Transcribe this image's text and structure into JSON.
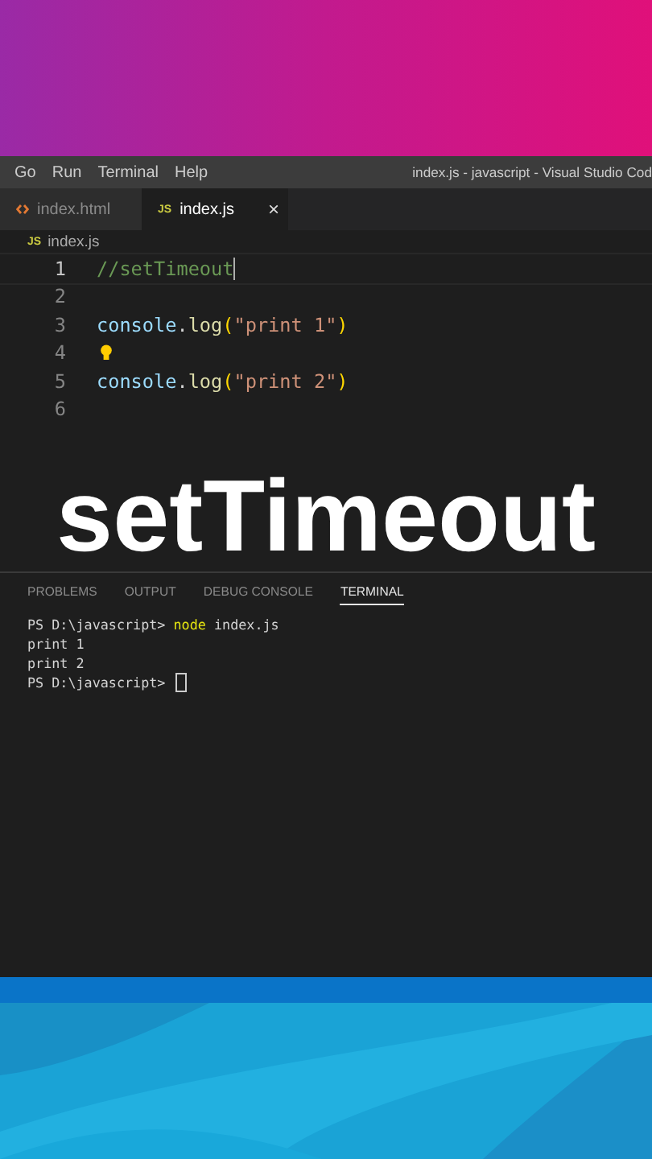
{
  "menu": {
    "items": [
      "Go",
      "Run",
      "Terminal",
      "Help"
    ],
    "title": "index.js - javascript - Visual Studio Cod"
  },
  "tabs": [
    {
      "label": "index.html",
      "kind": "html",
      "selected": false
    },
    {
      "label": "index.js",
      "kind": "js",
      "icon_text": "JS",
      "selected": true,
      "close": "×"
    }
  ],
  "breadcrumb": {
    "icon_text": "JS",
    "label": "index.js"
  },
  "editor": {
    "lines": [
      {
        "number": "1",
        "active": true,
        "cursor": true,
        "tokens": [
          {
            "kind": "comment",
            "text": "//setTimeout"
          }
        ]
      },
      {
        "number": "2",
        "active": false
      },
      {
        "number": "3",
        "active": false,
        "tokens": [
          {
            "kind": "variable",
            "text": "console"
          },
          {
            "kind": "plain",
            "text": "."
          },
          {
            "kind": "function",
            "text": "log"
          },
          {
            "kind": "bracket",
            "text": "("
          },
          {
            "kind": "string",
            "text": "\"print 1\""
          },
          {
            "kind": "bracket",
            "text": ")"
          }
        ]
      },
      {
        "number": "4",
        "active": false,
        "lightbulb": true
      },
      {
        "number": "5",
        "active": false,
        "tokens": [
          {
            "kind": "variable",
            "text": "console"
          },
          {
            "kind": "plain",
            "text": "."
          },
          {
            "kind": "function",
            "text": "log"
          },
          {
            "kind": "bracket",
            "text": "("
          },
          {
            "kind": "string",
            "text": "\"print 2\""
          },
          {
            "kind": "bracket",
            "text": ")"
          }
        ]
      },
      {
        "number": "6",
        "active": false
      }
    ]
  },
  "caption": "setTimeout",
  "panel": {
    "tabs": [
      {
        "label": "PROBLEMS",
        "selected": false
      },
      {
        "label": "OUTPUT",
        "selected": false
      },
      {
        "label": "DEBUG CONSOLE",
        "selected": false
      },
      {
        "label": "TERMINAL",
        "selected": true
      }
    ],
    "lines": [
      {
        "tokens": [
          {
            "kind": "plain",
            "text": "PS D:\\javascript> "
          },
          {
            "kind": "command",
            "text": "node"
          },
          {
            "kind": "plain",
            "text": " index.js"
          }
        ]
      },
      {
        "tokens": [
          {
            "kind": "plain",
            "text": "print 1"
          }
        ]
      },
      {
        "tokens": [
          {
            "kind": "plain",
            "text": "print 2"
          }
        ]
      },
      {
        "cursor": true,
        "tokens": [
          {
            "kind": "plain",
            "text": "PS D:\\javascript> "
          }
        ]
      }
    ]
  }
}
